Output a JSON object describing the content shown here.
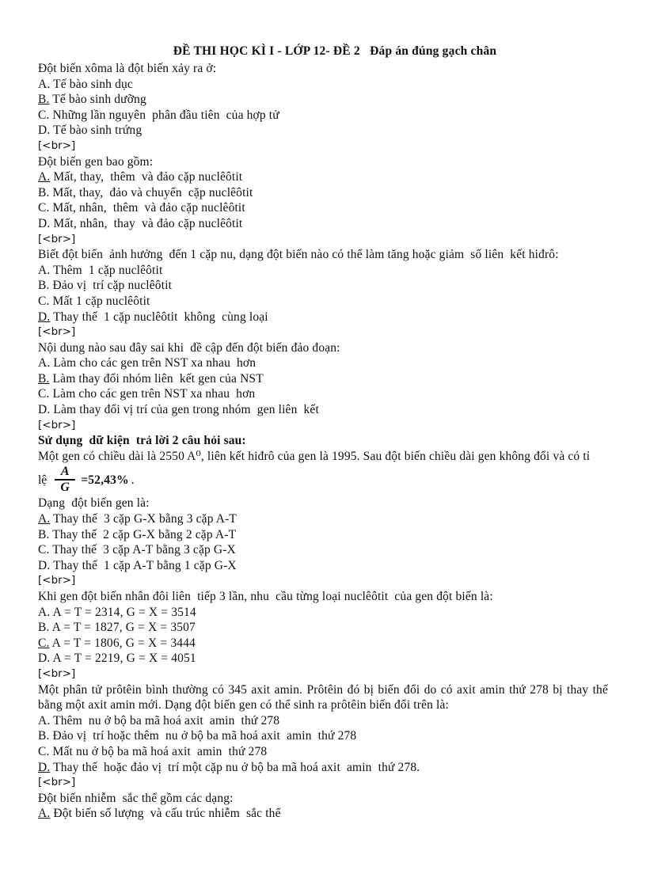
{
  "document": {
    "title": "ĐỀ THI HỌC KÌ I - LỚP 12- ĐỀ 2   Đáp án đúng gạch chân",
    "break_token": "[<br>]",
    "blocks": [
      {
        "stem": "Đột biến xôma là đột biến xảy ra ở:",
        "options": [
          {
            "key": "A.",
            "text": " Tế bào sinh dục",
            "correct": false
          },
          {
            "key": "B.",
            "text": " Tế bào sinh dưỡng",
            "correct": true
          },
          {
            "key": "C.",
            "text": " Những lần nguyên  phân đầu tiên  của hợp tử",
            "correct": false
          },
          {
            "key": "D.",
            "text": " Tế bào sinh trứng",
            "correct": false
          }
        ]
      },
      {
        "stem": "Đột biến gen bao gồm:",
        "options": [
          {
            "key": "A.",
            "text": " Mất, thay,  thêm  và đảo cặp nuclêôtit",
            "correct": true
          },
          {
            "key": "B.",
            "text": " Mất, thay,  đảo và chuyển  cặp nuclêôtit",
            "correct": false
          },
          {
            "key": "C.",
            "text": " Mất, nhân,  thêm  và đảo cặp nuclêôtit",
            "correct": false
          },
          {
            "key": "D.",
            "text": " Mất, nhân,  thay  và đảo cặp nuclêôtit",
            "correct": false
          }
        ]
      },
      {
        "stem": "Biết đột biến  ảnh hưởng  đến 1 cặp nu, dạng đột biến nào có thể làm tăng hoặc giảm  số liên  kết hiđrô:",
        "options": [
          {
            "key": "A.",
            "text": " Thêm  1 cặp nuclêôtit",
            "correct": false
          },
          {
            "key": "B.",
            "text": " Đảo vị  trí cặp nuclêôtit",
            "correct": false
          },
          {
            "key": "C.",
            "text": " Mất 1 cặp nuclêôtit",
            "correct": false
          },
          {
            "key": "D.",
            "text": " Thay thế  1 cặp nuclêôtit  không  cùng loại",
            "correct": true
          }
        ]
      },
      {
        "stem": "Nội dung nào sau đây sai khi  đề cập đến đột biến đảo đoạn:",
        "options": [
          {
            "key": "A.",
            "text": " Làm cho các gen trên NST xa nhau  hơn",
            "correct": false
          },
          {
            "key": "B.",
            "text": " Làm thay đổi nhóm liên  kết gen của NST",
            "correct": true
          },
          {
            "key": "C.",
            "text": " Làm cho các gen trên NST xa nhau  hơn",
            "correct": false
          },
          {
            "key": "D.",
            "text": " Làm thay đổi vị trí của gen trong nhóm  gen liên  kết",
            "correct": false
          }
        ]
      }
    ],
    "shared_data": {
      "heading": "Sử dụng  dữ kiện  trả lời 2 câu hỏi sau:",
      "paragraph": "Một gen có chiều  dài là 2550 A⁰, liên  kết hiđrô  của gen là 1995. Sau đột biến  chiều  dài gen không đổi và có tỉ",
      "formula_prefix": "lệ",
      "formula_numerator": "A",
      "formula_denominator": "G",
      "formula_equals": "=52,43%",
      "formula_tail": "."
    },
    "blocks2": [
      {
        "stem": "Dạng  đột biến gen là:",
        "options": [
          {
            "key": "A.",
            "text": " Thay thế  3 cặp G-X bằng 3 cặp A-T",
            "correct": true
          },
          {
            "key": "B.",
            "text": " Thay thế  2 cặp G-X bằng 2 cặp A-T",
            "correct": false
          },
          {
            "key": "C.",
            "text": " Thay thế  3 cặp A-T bằng 3 cặp G-X",
            "correct": false
          },
          {
            "key": "D.",
            "text": " Thay thế  1 cặp A-T bằng 1 cặp G-X",
            "correct": false
          }
        ]
      },
      {
        "stem": "Khi gen đột biến nhân đôi liên  tiếp 3 lần, nhu  cầu từng loại nuclêôtit  của gen đột biến là:",
        "options": [
          {
            "key": "A.",
            "text": " A = T = 2314, G = X = 3514",
            "correct": false
          },
          {
            "key": "B.",
            "text": " A = T = 1827, G = X = 3507",
            "correct": false
          },
          {
            "key": "C.",
            "text": " A = T = 1806, G = X = 3444",
            "correct": true
          },
          {
            "key": "D.",
            "text": " A = T = 2219, G = X = 4051",
            "correct": false
          }
        ]
      },
      {
        "stem": "Một phân tử prôtêin  bình  thường  có 345 axit amin.  Prôtêin  đó bị biến  đổi do có axit  amin  thứ 278 bị thay thế bằng một axit  amin  mới.  Dạng  đột biến  gen có thể sinh  ra prôtêin  biến  đổi trên là:",
        "options": [
          {
            "key": "A.",
            "text": " Thêm  nu ở bộ ba mã hoá axit  amin  thứ 278",
            "correct": false
          },
          {
            "key": "B.",
            "text": " Đảo vị  trí hoặc thêm  nu ở bộ ba mã hoá axit  amin  thứ 278",
            "correct": false
          },
          {
            "key": "C.",
            "text": " Mất nu ở bộ ba mã hoá axit  amin  thứ 278",
            "correct": false
          },
          {
            "key": "D.",
            "text": " Thay thế  hoặc đảo vị  trí một cặp nu ở bộ ba mã hoá axit  amin  thứ 278.",
            "correct": true
          }
        ]
      },
      {
        "stem": "Đột biến nhiễm  sắc thể gồm các dạng:",
        "options": [
          {
            "key": "A.",
            "text": " Đột biến số lượng  và cấu trúc nhiễm  sắc thể",
            "correct": true
          }
        ]
      }
    ]
  }
}
